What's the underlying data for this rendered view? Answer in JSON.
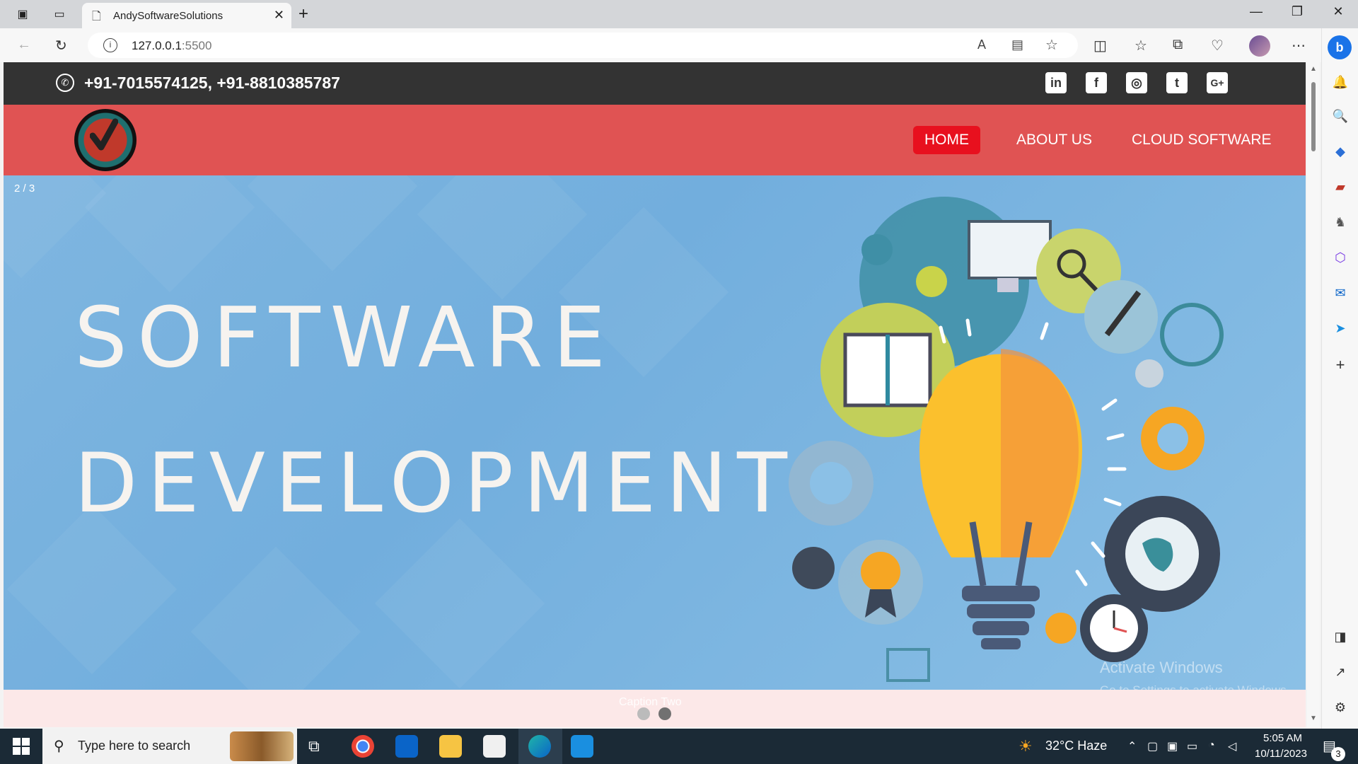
{
  "browser": {
    "tab_title": "AndySoftwareSolutions",
    "url_host": "127.0.0.1",
    "url_port": ":5500"
  },
  "site": {
    "phone": "+91-7015574125, +91-8810385787",
    "socials": [
      "linkedin-icon",
      "facebook-icon",
      "instagram-icon",
      "twitter-icon",
      "google-plus-icon"
    ],
    "social_glyphs": [
      "in",
      "f",
      "◎",
      "t",
      "G+"
    ],
    "nav": {
      "home": "HOME",
      "about": "ABOUT US",
      "cloud": "CLOUD SOFTWARE"
    },
    "colors": {
      "topbar": "#333333",
      "nav_bg": "#e05353",
      "nav_active": "#e8101e",
      "page_bg": "#fce8e8"
    }
  },
  "slider": {
    "counter": "2 / 3",
    "line1": "SOFTWARE",
    "line2": "DEVELOPMENT",
    "caption": "Caption Two",
    "active_slide": 2,
    "total_dots": 2
  },
  "watermark": {
    "line1": "Activate Windows",
    "line2": "Go to Settings to activate Windows."
  },
  "taskbar": {
    "search_placeholder": "Type here to search",
    "weather": "32°C  Haze",
    "time": "5:05 AM",
    "date": "10/11/2023",
    "notifications": "3"
  }
}
